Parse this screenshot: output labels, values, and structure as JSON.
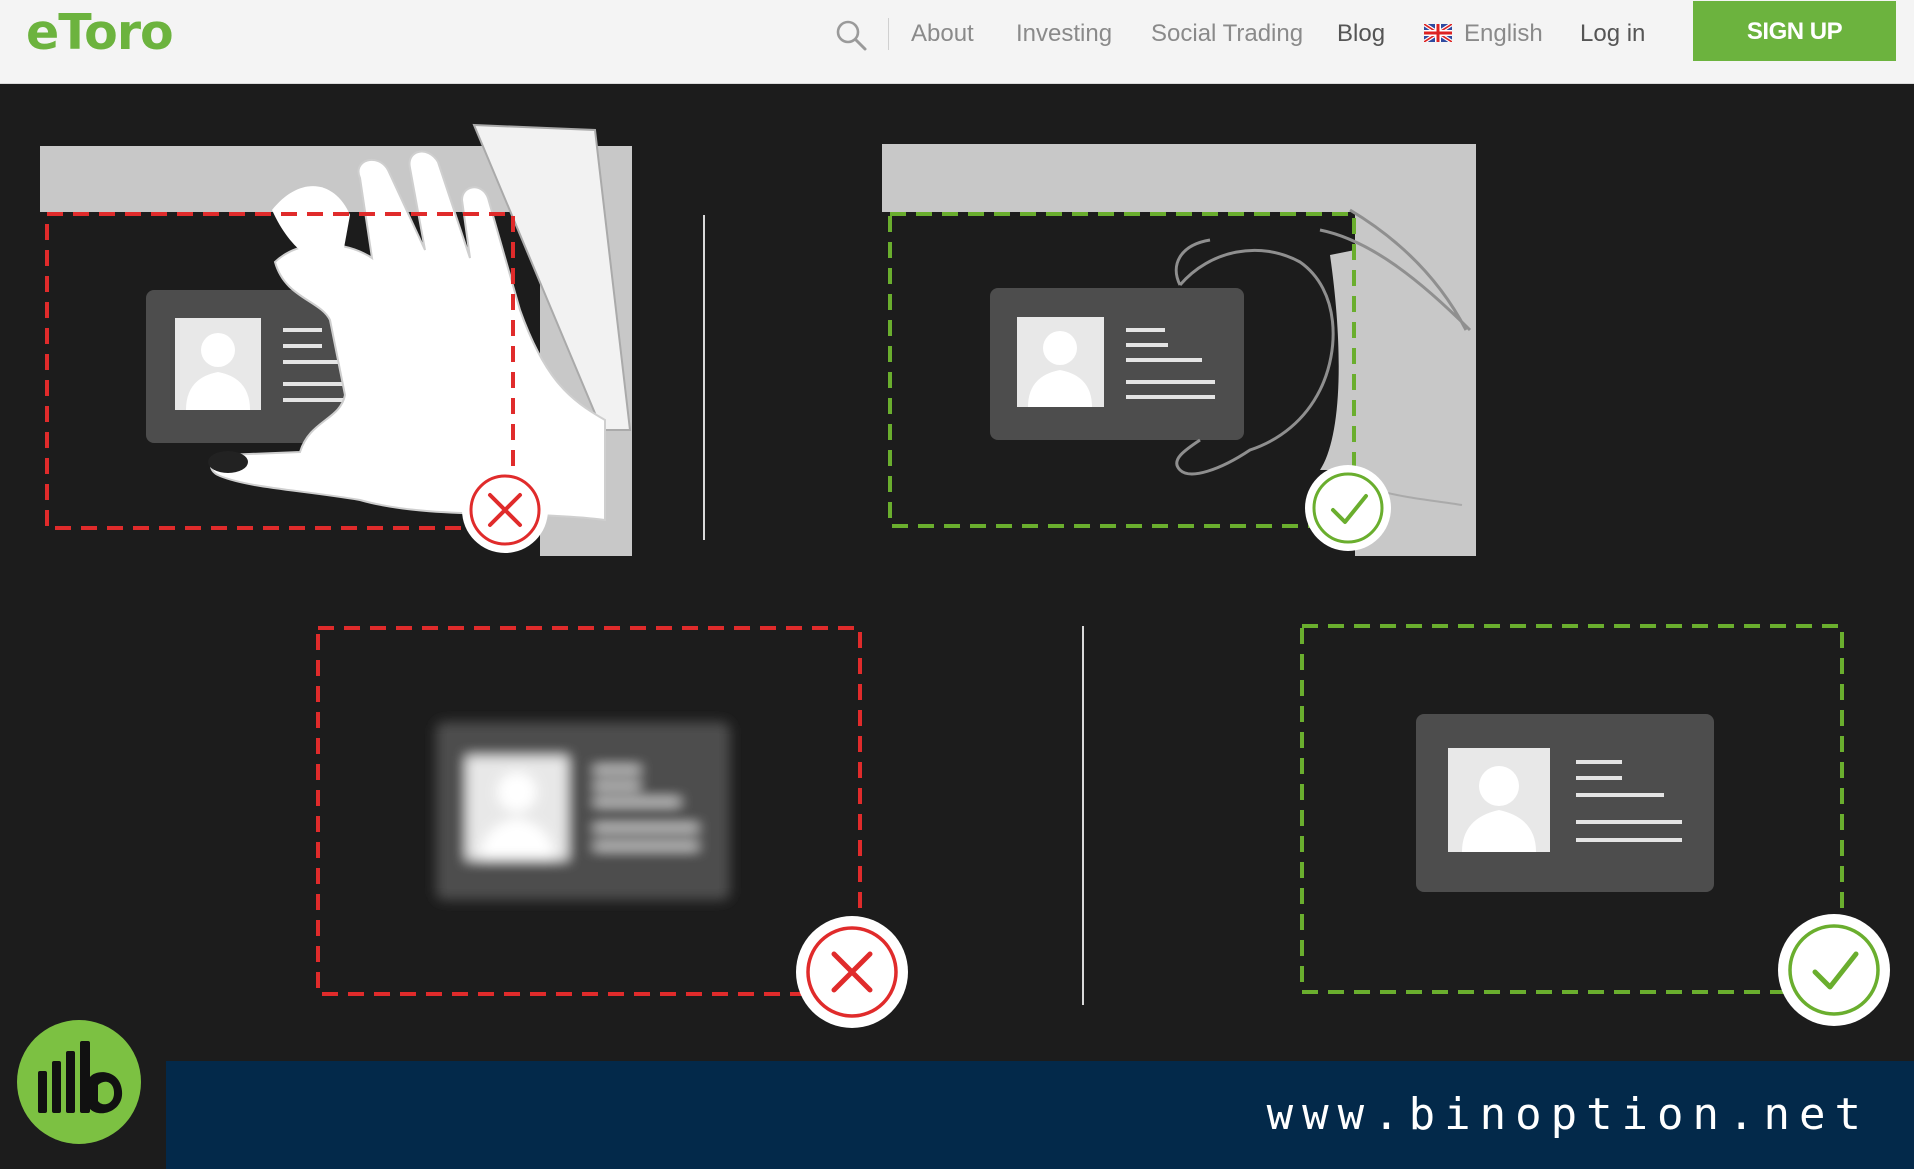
{
  "header": {
    "logo_text": "eToro",
    "search_icon": "search-icon",
    "nav": {
      "about": "About",
      "investing": "Investing",
      "social_trading": "Social Trading",
      "blog": "Blog",
      "language": "English",
      "login": "Log in"
    },
    "flag_icon": "uk-flag-icon",
    "signup_label": "SIGN UP"
  },
  "illustration": {
    "panels": [
      {
        "id": "hand-covering-id",
        "status": "wrong",
        "status_icon": "x-icon"
      },
      {
        "id": "hand-holding-id",
        "status": "correct",
        "status_icon": "check-icon"
      },
      {
        "id": "blurry-id",
        "status": "wrong",
        "status_icon": "x-icon"
      },
      {
        "id": "clear-id",
        "status": "correct",
        "status_icon": "check-icon"
      }
    ],
    "colors": {
      "background": "#1c1c1c",
      "wrong": "#e02b2b",
      "correct": "#6aae2e",
      "card": "#4d4d4d",
      "paper": "#c8c8c8"
    }
  },
  "footer": {
    "url": "www.binoption.net",
    "badge_icon": "binoption-logo-icon",
    "colors": {
      "bar": "#03294a",
      "badge": "#7cc142"
    }
  }
}
